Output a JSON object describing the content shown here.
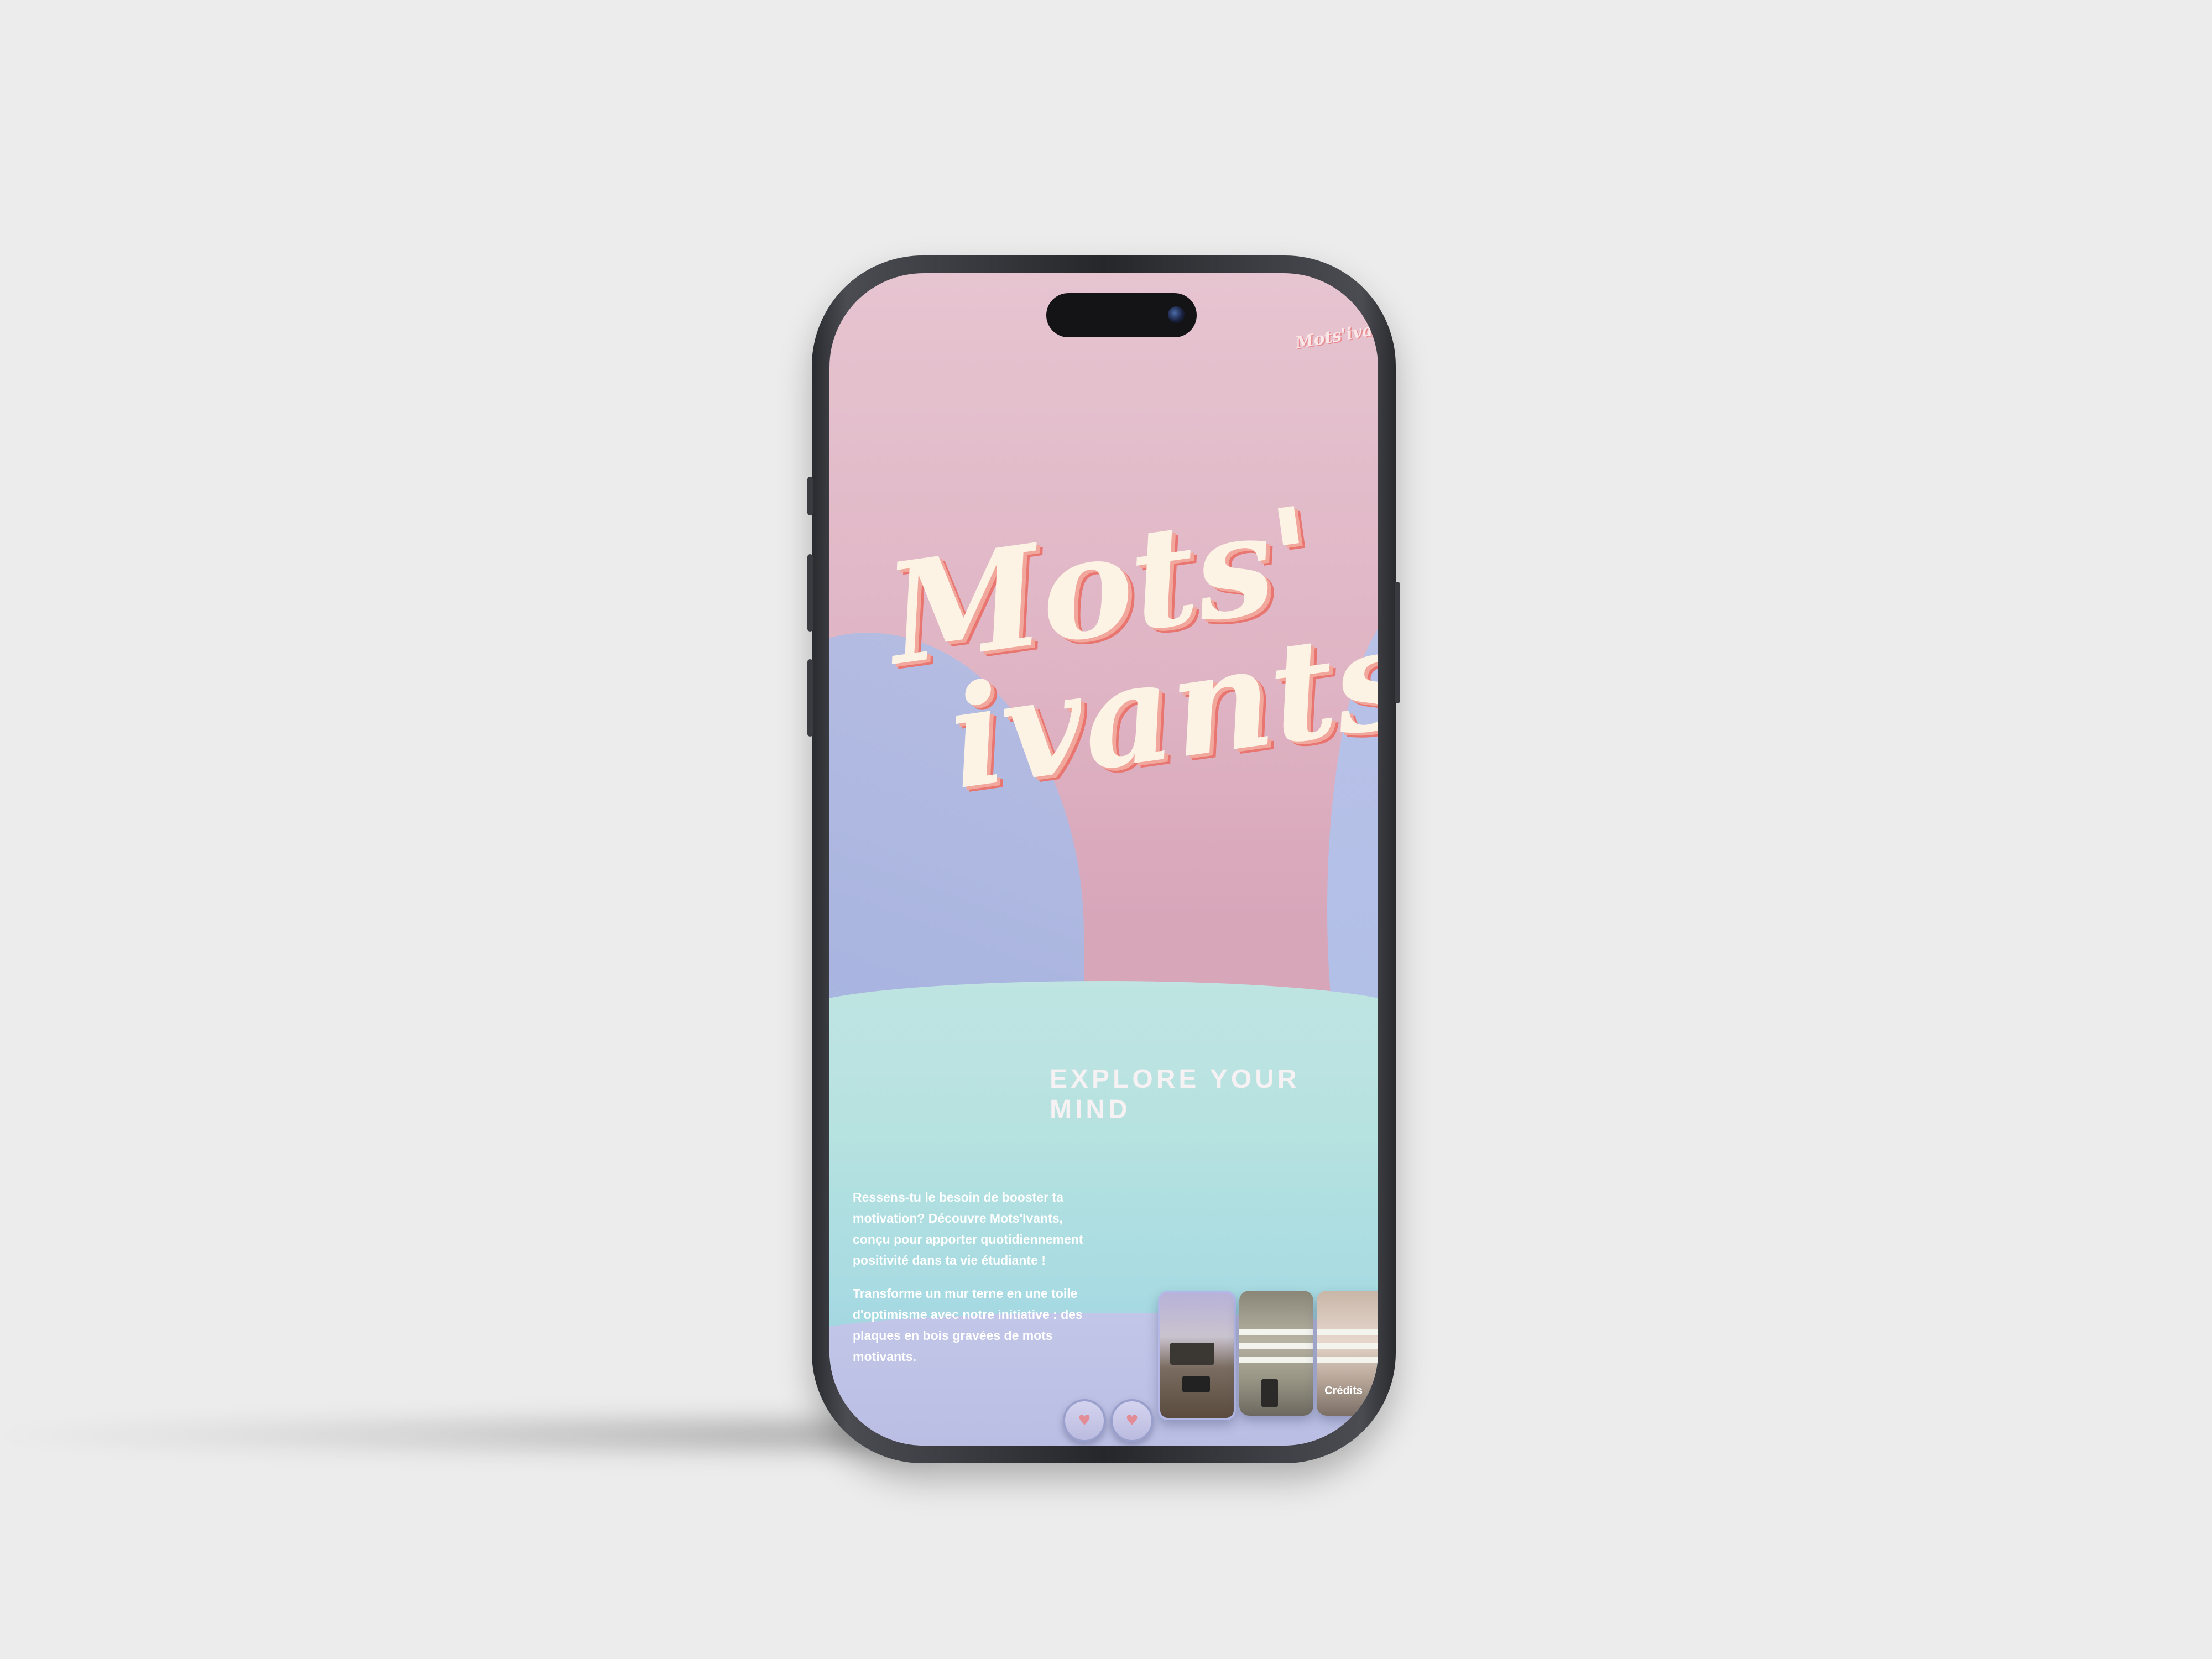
{
  "app": {
    "logo_small": "Mots'ivants",
    "title_line1": "Mots'",
    "title_line2": "ivants",
    "tagline": "EXPLORE YOUR MIND"
  },
  "intro": {
    "paragraph1": "Ressens-tu le besoin de booster ta motivation? Découvre Mots'Ivants, conçu pour apporter quotidiennement positivité dans ta vie étudiante !",
    "paragraph2": "Transforme un mur terne en une toile d'optimisme avec notre initiative : des plaques en bois gravées de mots motivants."
  },
  "gallery": {
    "items": [
      "room-photo",
      "wall-plaque-photo",
      "wall-plaque-photo"
    ]
  },
  "footer": {
    "credits": "Crédits",
    "nav_prev_icon": "heart-icon",
    "nav_next_icon": "heart-icon"
  },
  "colors": {
    "background": "#ececec",
    "screen_pink": "#e6c4d0",
    "lilac": "#b7bde2",
    "teal": "#b6e2e0",
    "title_cream": "#fdf3e4",
    "title_shadow": "#e8756f"
  }
}
